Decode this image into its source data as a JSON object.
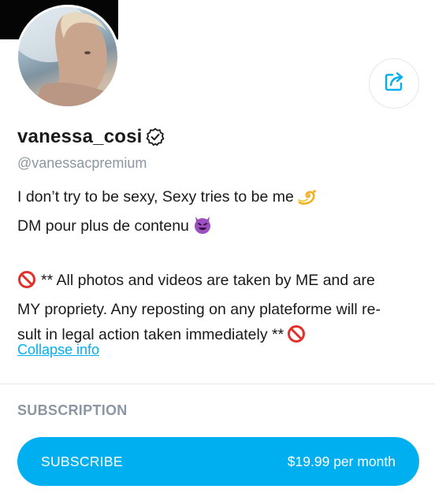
{
  "profile": {
    "username": "vanessa_cosi",
    "handle": "@vanessacpremium",
    "verified_icon": "verified-badge-icon",
    "avatar_alt": "profile photo"
  },
  "header": {
    "share_icon": "share-icon"
  },
  "bio": {
    "line1": "I don’t try to be sexy, Sexy tries to be me",
    "line1_emoji": "dizzy-emoji",
    "line2": "DM pour plus de contenu",
    "line2_emoji": "smiling-devil-emoji",
    "line3": "** All photos and videos are taken by ME and are",
    "line4": "MY propriety. Any reposting on any plateforme will re-",
    "line5": "sult in legal action taken immediately **",
    "prohibited_emoji": "no-entry-sign-emoji",
    "collapse_label": "Collapse info"
  },
  "subscription": {
    "heading": "SUBSCRIPTION",
    "button_label": "SUBSCRIBE",
    "price": "$19.99 per month"
  },
  "colors": {
    "accent": "#00aff0",
    "muted": "#8a96a3",
    "text": "#1a1a1a",
    "divider": "#e4e6ea"
  }
}
